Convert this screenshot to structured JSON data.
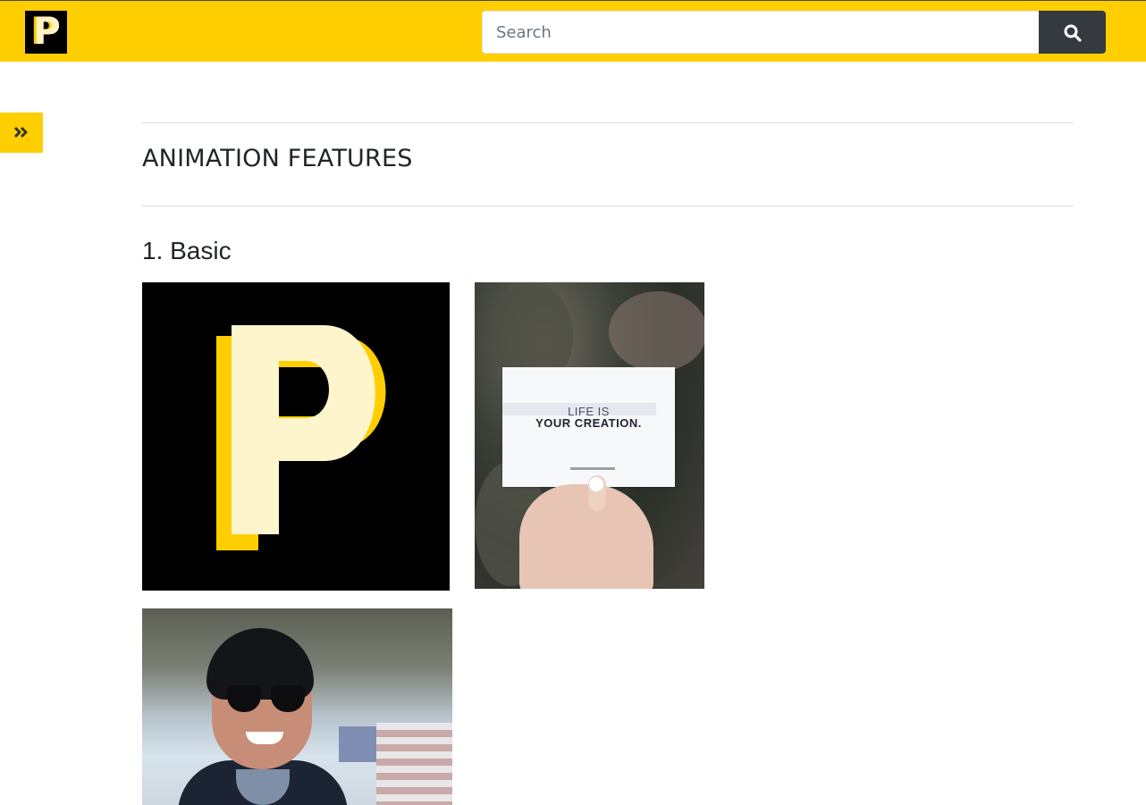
{
  "header": {
    "logo_letter": "P",
    "search": {
      "placeholder": "Search",
      "value": ""
    },
    "search_icon": "search-icon"
  },
  "sidebar_toggle": {
    "icon": "double-chevron-right-icon"
  },
  "main": {
    "section_title": "ANIMATION FEATURES",
    "subsection_title": "1. Basic",
    "images": [
      {
        "name": "animated-p-logo-image"
      },
      {
        "name": "life-is-your-creation-card-image",
        "text_line1": "LIFE IS",
        "text_line2": "YOUR CREATION."
      },
      {
        "name": "man-sunglasses-image"
      }
    ]
  },
  "colors": {
    "brand_yellow": "#ffce00",
    "button_dark": "#343a40",
    "heading": "#212529"
  }
}
